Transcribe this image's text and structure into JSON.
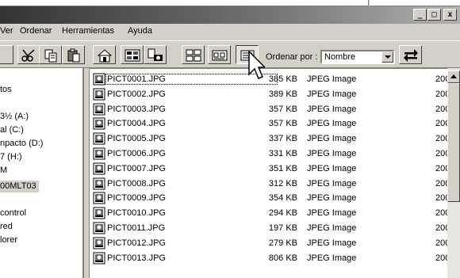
{
  "window": {
    "controls": {
      "minimize": "_",
      "restore": "□",
      "close": "x"
    }
  },
  "menubar": {
    "items": [
      "Ver",
      "Ordenar",
      "Herramientas",
      "Ayuda"
    ]
  },
  "toolbar": {
    "buttons": [
      "cut-icon",
      "copy-icon",
      "paste-icon",
      "home-folder-icon",
      "slideshow-icon",
      "camera-import-icon",
      "thumbnails-icon",
      "list-view-icon",
      "details-view-icon"
    ],
    "pressed": "details-view-icon",
    "sort_label": "Ordenar por :",
    "sort_value": "Nombre",
    "swap_icon": "sort-order-icon"
  },
  "tree": {
    "items": [
      "tos",
      "3½ (A:)",
      "al (C:)",
      "npacto (D:)",
      "7 (H:)",
      "M",
      "00MLT03",
      "control",
      "red",
      "lorer"
    ],
    "selected": "00MLT03"
  },
  "files": [
    {
      "name": "PICT0001.JPG",
      "size": "385 KB",
      "type": "JPEG Image",
      "date": "200"
    },
    {
      "name": "PICT0002.JPG",
      "size": "389 KB",
      "type": "JPEG Image",
      "date": "200"
    },
    {
      "name": "PICT0003.JPG",
      "size": "357 KB",
      "type": "JPEG Image",
      "date": "200"
    },
    {
      "name": "PICT0004.JPG",
      "size": "357 KB",
      "type": "JPEG Image",
      "date": "200"
    },
    {
      "name": "PICT0005.JPG",
      "size": "337 KB",
      "type": "JPEG Image",
      "date": "200"
    },
    {
      "name": "PICT0006.JPG",
      "size": "331 KB",
      "type": "JPEG Image",
      "date": "200"
    },
    {
      "name": "PICT0007.JPG",
      "size": "351 KB",
      "type": "JPEG Image",
      "date": "200"
    },
    {
      "name": "PICT0008.JPG",
      "size": "312 KB",
      "type": "JPEG Image",
      "date": "200"
    },
    {
      "name": "PICT0009.JPG",
      "size": "354 KB",
      "type": "JPEG Image",
      "date": "200"
    },
    {
      "name": "PICT0010.JPG",
      "size": "294 KB",
      "type": "JPEG Image",
      "date": "200"
    },
    {
      "name": "PICT0011.JPG",
      "size": "197 KB",
      "type": "JPEG Image",
      "date": "200"
    },
    {
      "name": "PICT0012.JPG",
      "size": "279 KB",
      "type": "JPEG Image",
      "date": "200"
    },
    {
      "name": "PICT0013.JPG",
      "size": "806 KB",
      "type": "JPEG Image",
      "date": "200"
    }
  ],
  "colors": {
    "title_gradient_start": "#333333",
    "title_gradient_end": "#b0b0b0",
    "face": "#d4d0c8"
  }
}
